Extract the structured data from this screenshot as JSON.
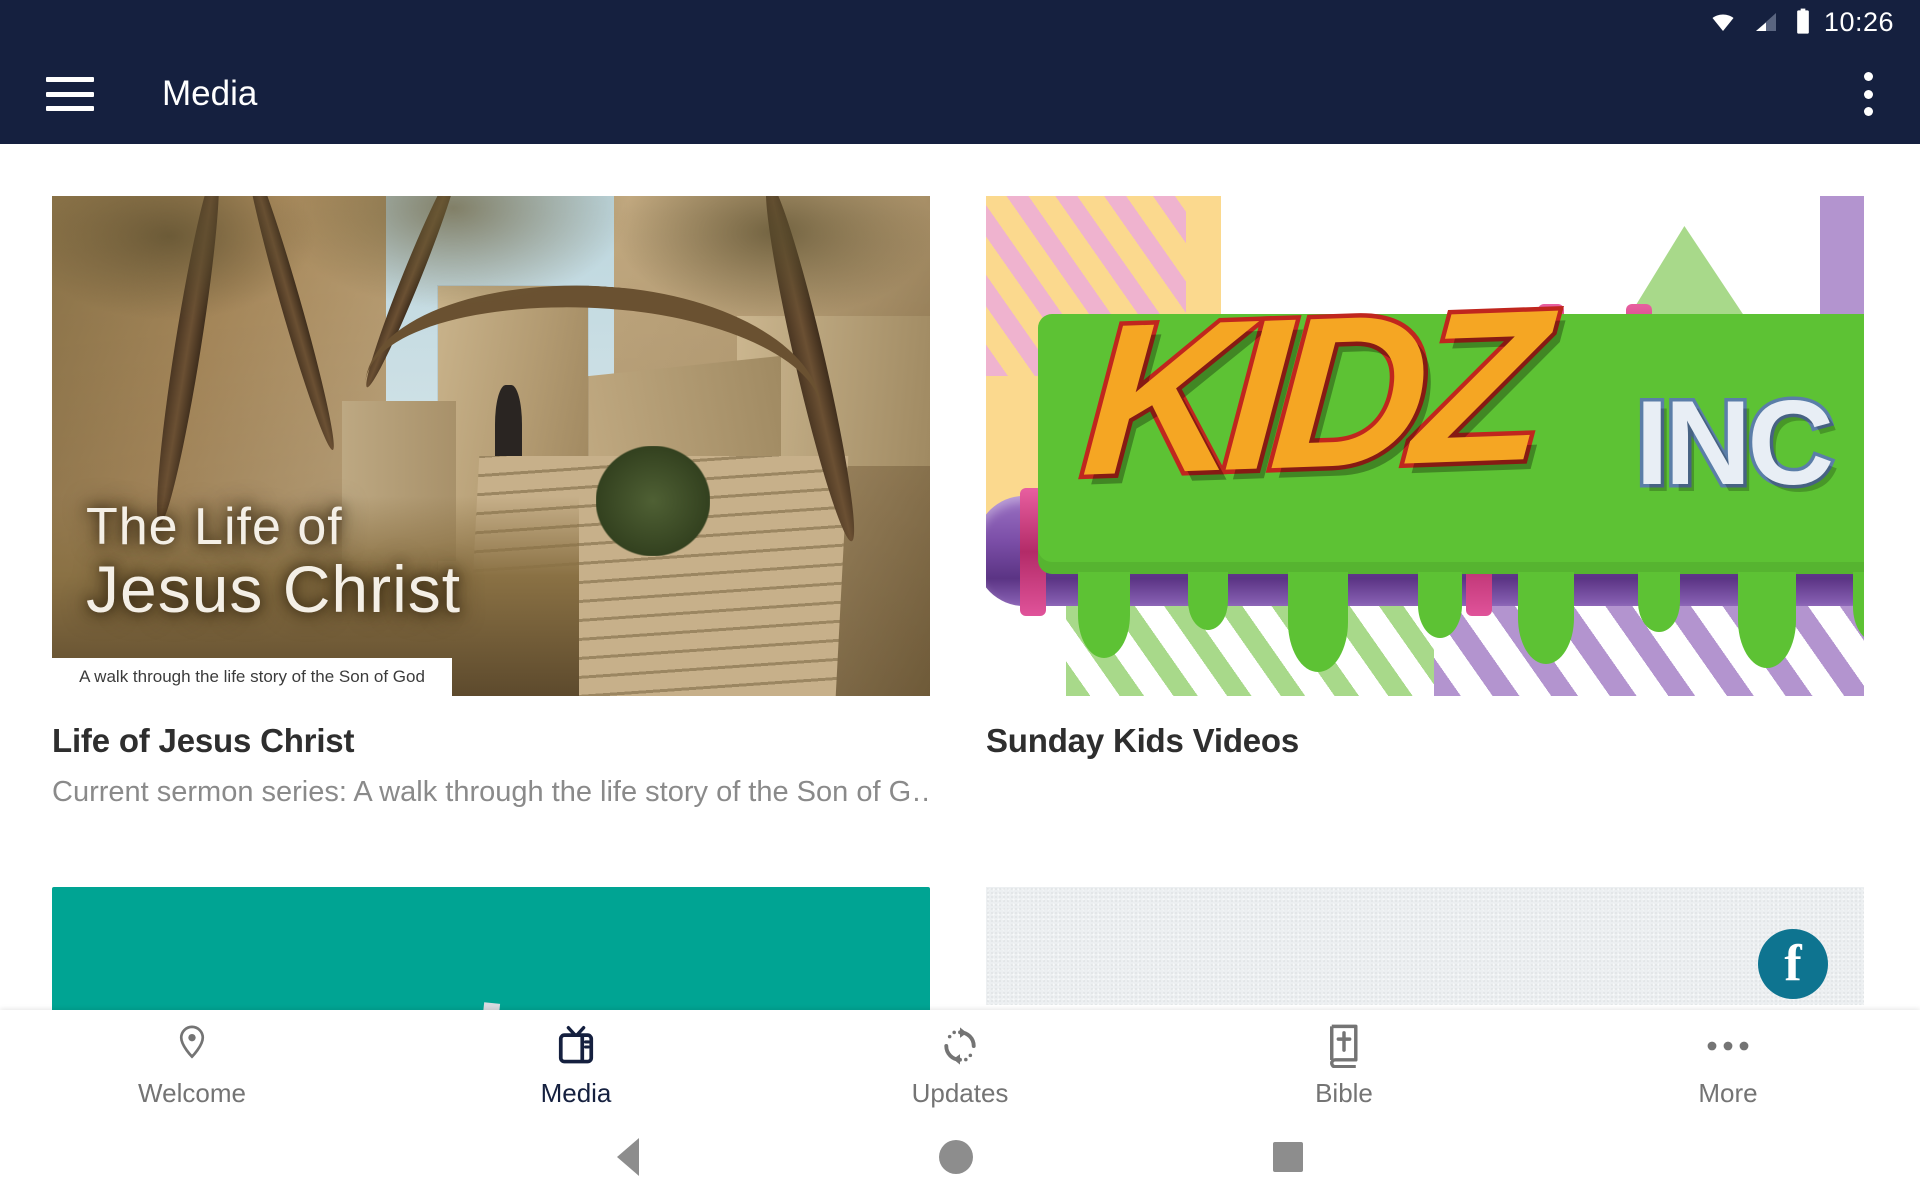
{
  "status_bar": {
    "time": "10:26",
    "icons": [
      "wifi-icon",
      "cellular-signal-icon",
      "battery-icon"
    ]
  },
  "app_bar": {
    "title": "Media",
    "menu_icon": "hamburger-menu-icon",
    "overflow_icon": "more-vertical-icon",
    "background_color": "#15203f"
  },
  "cards": [
    {
      "title": "Life of Jesus Christ",
      "description": "Current sermon series: A walk through the life story of the Son of G…",
      "artwork": {
        "headline_line1": "The Life of",
        "headline_line2": "Jesus Christ",
        "caption": "A walk through the life story of the Son of God"
      }
    },
    {
      "title": "Sunday Kids Videos",
      "description": "",
      "artwork": {
        "logo_word": "KIDZ",
        "logo_word2": "INC",
        "colors": {
          "slime": "#5dc234",
          "pipe": "#7c4fa8",
          "letter": "#f5a623",
          "letter_outline": "#c0261e"
        }
      }
    }
  ],
  "row2": {
    "teal_card_color": "#00a493",
    "gray_card_color": "#eceff1",
    "badge_letter": "f"
  },
  "bottom_nav": {
    "items": [
      {
        "label": "Welcome",
        "icon": "location-pin-icon",
        "active": false
      },
      {
        "label": "Media",
        "icon": "television-icon",
        "active": true
      },
      {
        "label": "Updates",
        "icon": "sync-refresh-icon",
        "active": false
      },
      {
        "label": "Bible",
        "icon": "book-cross-icon",
        "active": false
      },
      {
        "label": "More",
        "icon": "more-horizontal-icon",
        "active": false
      }
    ],
    "active_color": "#15203f",
    "inactive_color": "#747474"
  },
  "system_bar": {
    "back": "back-triangle-icon",
    "home": "home-circle-icon",
    "recents": "recents-square-icon"
  }
}
